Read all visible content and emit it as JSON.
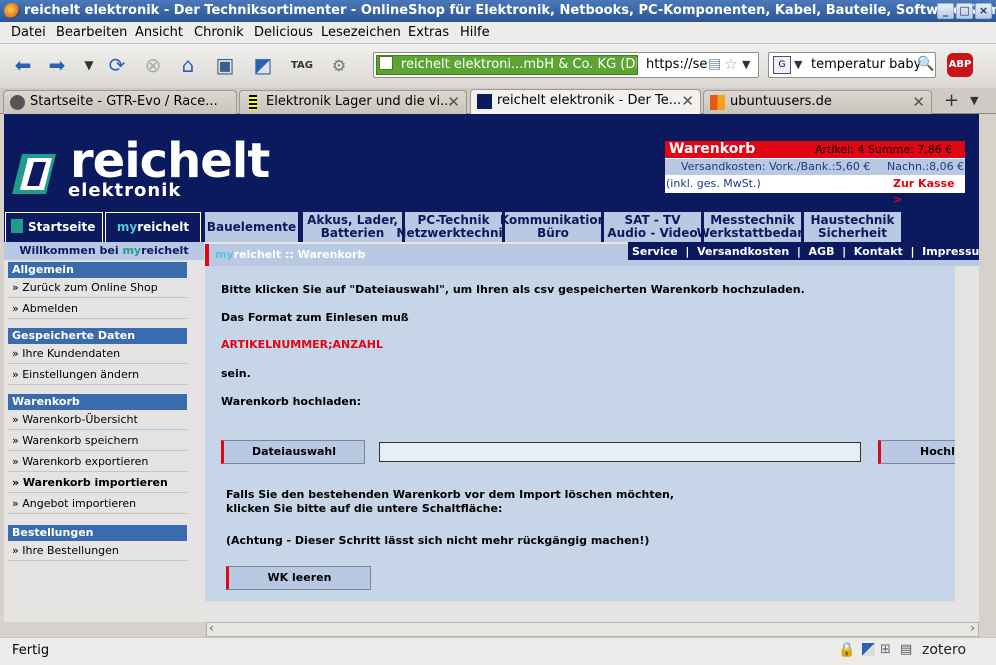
{
  "window": {
    "title": "reichelt elektronik - Der Techniksortimenter - OnlineShop für Elektronik, Netbooks, PC-Komponenten, Kabel, Bauteile, Software &am"
  },
  "menubar": {
    "items": [
      "Datei",
      "Bearbeiten",
      "Ansicht",
      "Chronik",
      "Delicious",
      "Lesezeichen",
      "Extras",
      "Hilfe"
    ]
  },
  "navbar": {
    "identity": "reichelt elektroni...mbH & Co. KG (DE)",
    "url": "https://se",
    "search": "temperatur baby",
    "abp": "ABP"
  },
  "tabs": [
    {
      "label": "Startseite - GTR-Evo / Race..."
    },
    {
      "label": "Elektronik Lager und die vi..."
    },
    {
      "label": "reichelt elektronik - Der Te..."
    },
    {
      "label": "ubuntuusers.de"
    }
  ],
  "header": {
    "logo": "reichelt",
    "logo_sub": "elektronik"
  },
  "cart": {
    "title": "Warenkorb",
    "artikel": "Artikel: 4  Summe: 7,86 €",
    "versand": "Versandkosten: Vork./Bank.:5,60 €",
    "nachn": "Nachn.:8,06 €",
    "mwst": "(inkl. ges. MwSt.)",
    "kasse": "Zur Kasse >"
  },
  "navtabs": {
    "startseite": "Startseite",
    "myreichelt_pre": "my",
    "myreichelt_post": "reichelt",
    "bauelemente": "Bauelemente",
    "akkus": [
      "Akkus, Lader,",
      "Batterien"
    ],
    "pc": [
      "PC-Technik",
      "Netzwerktechnik"
    ],
    "komm": [
      "Kommunikation",
      "Büro"
    ],
    "sat": [
      "SAT - TV",
      "Audio - Video"
    ],
    "mess": [
      "Messtechnik",
      "Werkstattbedarf"
    ],
    "haus": [
      "Haustechnik",
      "Sicherheit"
    ]
  },
  "sidebar": {
    "welcome_pre": "Willkommen bei ",
    "welcome_my": "my",
    "welcome_post": "reichelt",
    "sections": [
      {
        "title": "Allgemein",
        "items": [
          "» Zurück zum Online Shop",
          "» Abmelden"
        ]
      },
      {
        "title": "Gespeicherte Daten",
        "items": [
          "» Ihre Kundendaten",
          "» Einstellungen ändern"
        ]
      },
      {
        "title": "Warenkorb",
        "items": [
          "» Warenkorb-Übersicht",
          "» Warenkorb speichern",
          "» Warenkorb exportieren",
          "» Warenkorb importieren",
          "» Angebot importieren"
        ]
      },
      {
        "title": "Bestellungen",
        "items": [
          "» Ihre Bestellungen"
        ]
      }
    ]
  },
  "content": {
    "crumb_my": "my",
    "crumb_rest": "reichelt :: Warenkorb",
    "toplinks": "Service  |  Versandkosten  |  AGB  |  Kontakt  |  Impressum  |  Hilfe",
    "line1": "Bitte klicken Sie auf \"Dateiauswahl\", um Ihren als csv gespeicherten Warenkorb hochzuladen.",
    "line2": "Das Format zum Einlesen muß",
    "format": "ARTIKELNUMMER;ANZAHL",
    "line3": "sein.",
    "line4": "Warenkorb hochladen:",
    "btn_file": "Dateiauswahl",
    "btn_upload": "Hochl",
    "line5": "Falls Sie den bestehenden Warenkorb vor dem Import löschen möchten,",
    "line6": "klicken Sie bitte auf die untere Schaltfläche:",
    "line7": "(Achtung - Dieser Schritt lässt sich nicht mehr rückgängig machen!)",
    "btn_clear": "WK leeren"
  },
  "statusbar": {
    "status": "Fertig",
    "zotero": "zotero"
  },
  "colors": {
    "navy": "#0b1a5e",
    "red": "#e20614",
    "lightblue": "#b9c9e4"
  }
}
